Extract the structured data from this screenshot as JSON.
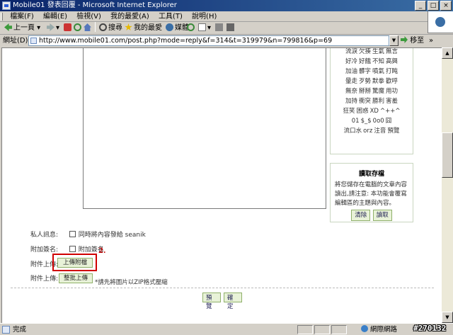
{
  "window": {
    "title": "Mobile01 發表回覆 - Microsoft Internet Explorer",
    "buttons": [
      "_",
      "□",
      "×"
    ]
  },
  "menu": {
    "items": [
      "檔案(F)",
      "編輯(E)",
      "檢視(V)",
      "我的最愛(A)",
      "工具(T)",
      "說明(H)"
    ]
  },
  "toolbar": {
    "back_label": "上一頁",
    "search_label": "搜尋",
    "favorites_label": "我的最愛",
    "media_label": "媒體"
  },
  "address": {
    "label": "網址(D)",
    "url": "http://www.mobile01.com/post.php?mode=reply&f=314&t=319979&n=799816&p=69",
    "go_label": "移至",
    "links_label": "»"
  },
  "smileys": {
    "rows": [
      [
        "流淚",
        "欠揍",
        "生氣",
        "無言"
      ],
      [
        "好冷",
        "好餓",
        "不知",
        "高興"
      ],
      [
        "加油",
        "髒字",
        "噴氣",
        "打盹"
      ],
      [
        "暈走",
        "歹勢",
        "默拳",
        "歡呼"
      ],
      [
        "無奈",
        "掰掰",
        "驚魔",
        "用功"
      ],
      [
        "加持",
        "衝突",
        "勝利",
        "害羞"
      ],
      [
        "狂笑",
        "困惑",
        "XD",
        "^++^"
      ],
      [
        "01",
        "$_$",
        "0o0",
        "囧"
      ],
      [
        "流口水",
        "orz",
        "注音",
        "預覽"
      ]
    ]
  },
  "draft": {
    "title": "讀取存檔",
    "text": "將您儲存在電腦的文章內容讀出,請注意: 本功能會覆寫編輯區的主題與內容。",
    "clear_label": "清除",
    "read_label": "讀取"
  },
  "form": {
    "private_label": "私人訊息:",
    "private_option": "同時將內容發給 seanik",
    "signature_label": "附加簽名:",
    "signature_option": "附加簽名",
    "attach_label": "附件上傳:",
    "attach_button": "上傳附檔",
    "batch_label": "附件上傳:",
    "batch_button": "整批上傳",
    "batch_note": "*請先將圖片以ZIP格式壓縮",
    "step_marker": "2.",
    "preview_button": "預覽",
    "submit_button": "確定"
  },
  "status": {
    "text": "完成",
    "zone": "網際網路"
  },
  "watermark": "#270132"
}
